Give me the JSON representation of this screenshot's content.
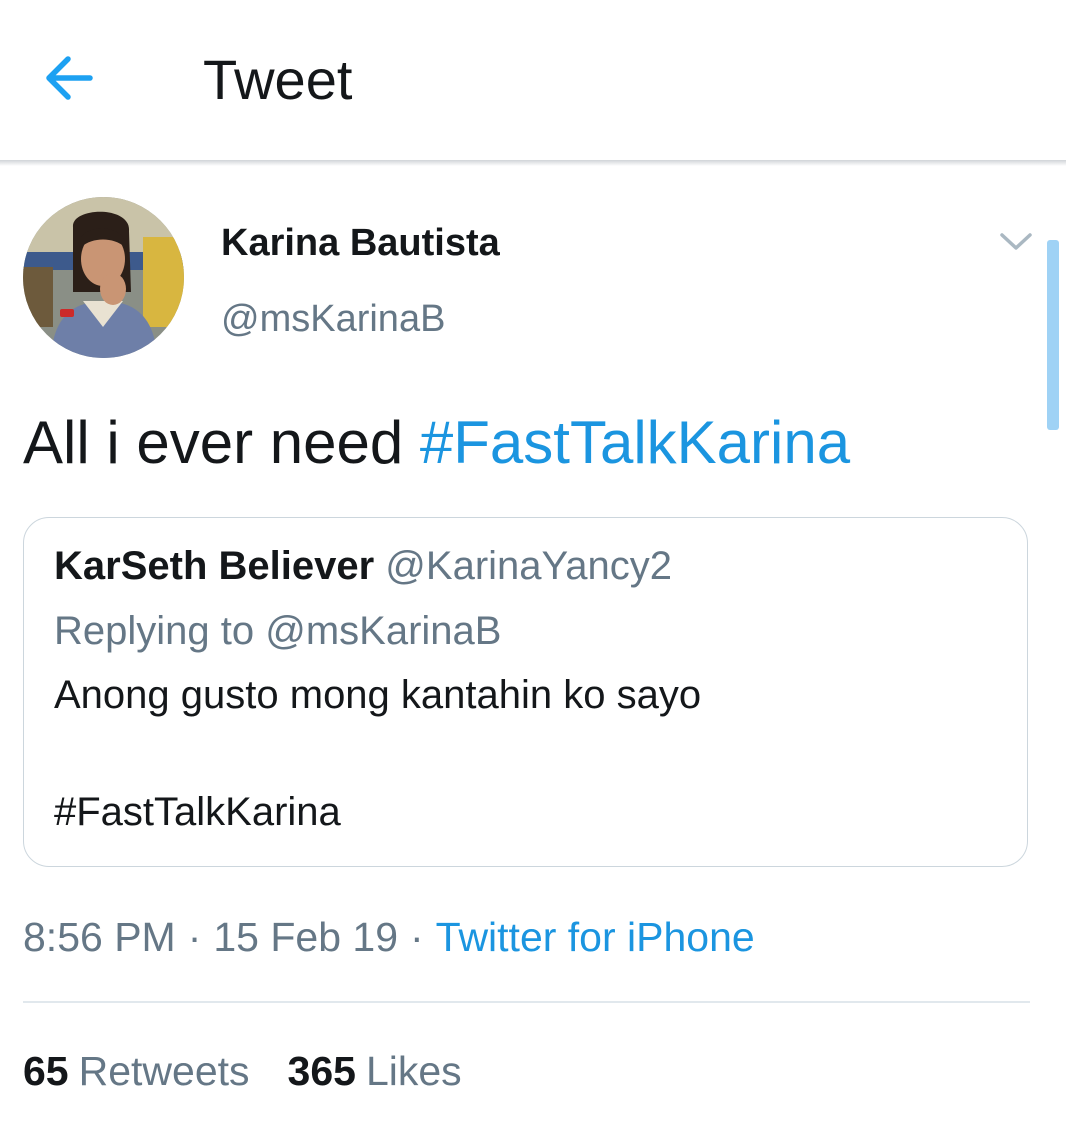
{
  "header": {
    "back_icon": "arrow-left-icon",
    "title": "Tweet",
    "accent_color": "#1da1f2"
  },
  "tweet": {
    "author": {
      "name": "Karina Bautista",
      "handle": "@msKarinaB",
      "avatar_icon": "avatar-photo"
    },
    "menu_icon": "chevron-down-icon",
    "text_plain": "All i ever need",
    "hashtag": "#FastTalkKarina",
    "quoted": {
      "name": "KarSeth Believer",
      "handle": "@KarinaYancy2",
      "replying_to": "Replying to @msKarinaB",
      "text_line1": "Anong gusto mong kantahin ko sayo",
      "text_line2": "#FastTalkKarina"
    },
    "time": "8:56 PM",
    "date": "15 Feb 19",
    "separator": "·",
    "source": "Twitter for iPhone",
    "retweets_count": "65",
    "retweets_label": "Retweets",
    "likes_count": "365",
    "likes_label": "Likes"
  },
  "colors": {
    "link": "#1b95e0",
    "secondary_text": "#657786",
    "primary_text": "#14171a",
    "border": "#ccd6dd"
  }
}
